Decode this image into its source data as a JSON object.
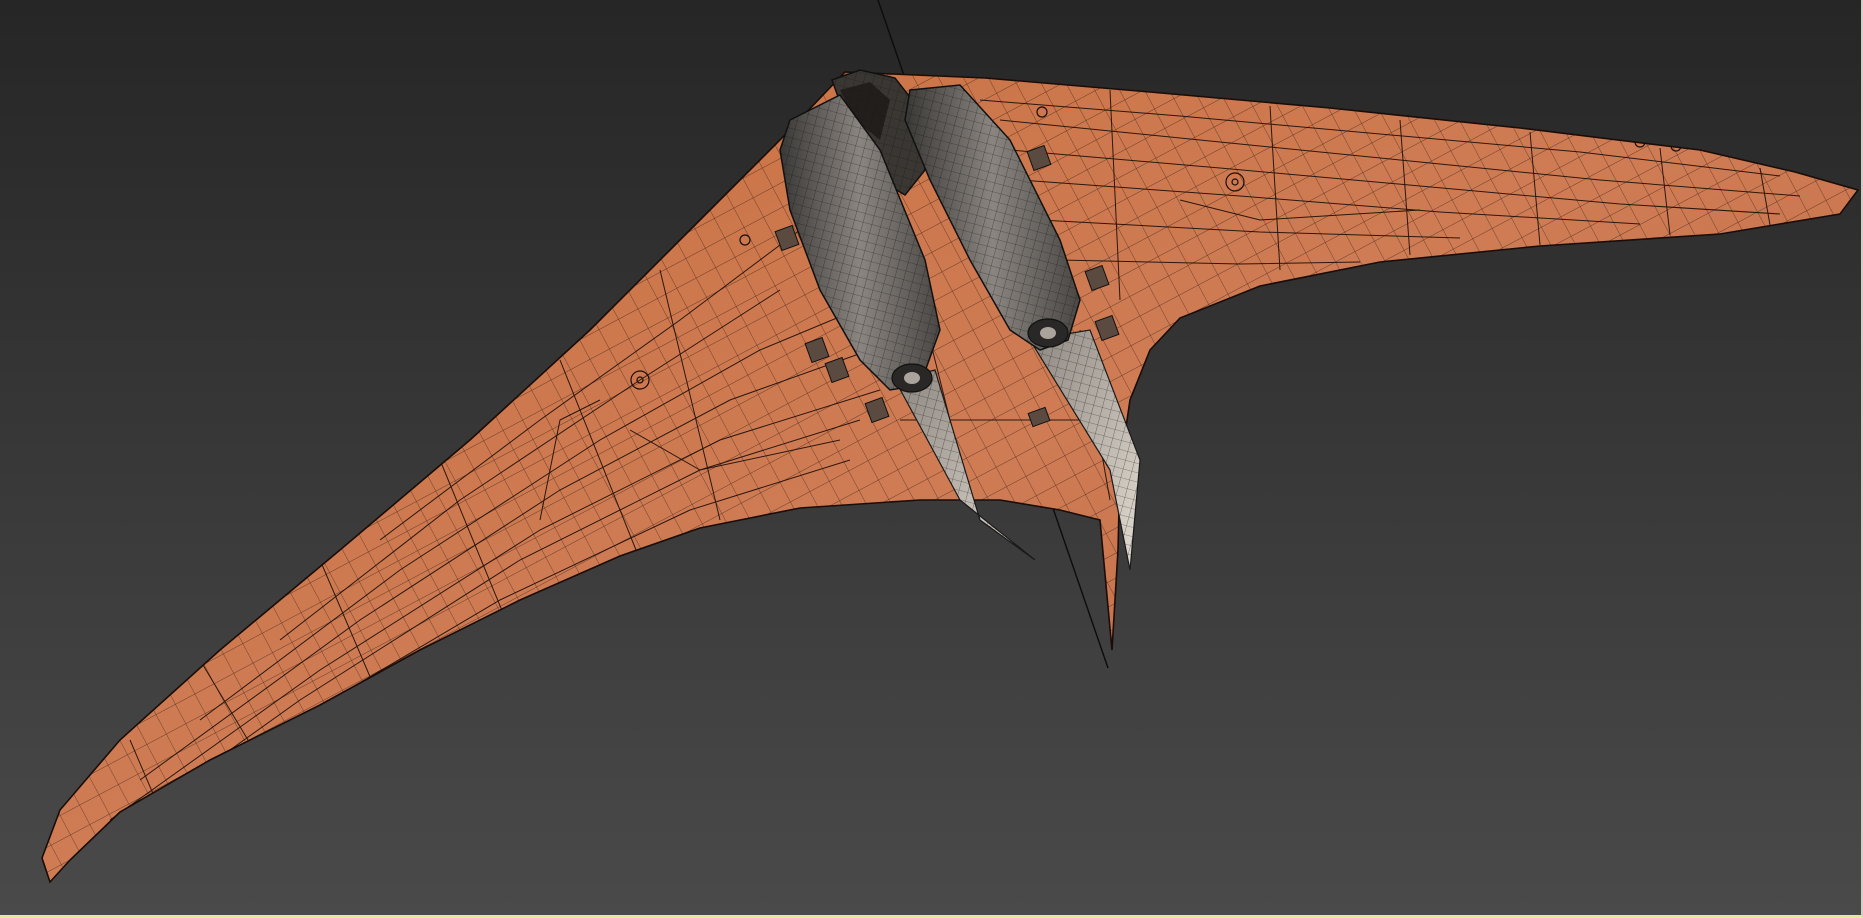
{
  "viewport": {
    "background_top": "#262626",
    "background_bottom": "#4a4a4a",
    "frame_color": "#e8e6a0"
  },
  "model": {
    "skin_color": "#c56a45",
    "skin_light": "#d98762",
    "skin_dark": "#8c4426",
    "wire_color": "#1a0d08",
    "nacelle_color": "#6a6560",
    "nacelle_wire": "#1c1c1c",
    "exhaust_color": "#c8c2b8",
    "icons": [
      "axis-gizmo-line",
      "wireframe-mesh",
      "jet-engine-nacelle"
    ]
  }
}
